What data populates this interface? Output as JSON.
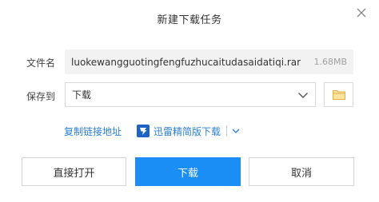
{
  "dialog": {
    "title": "新建下载任务"
  },
  "file": {
    "label": "文件名",
    "name": "luokewangguotingfengfuzhucaitudasaidatiqi.rar",
    "size": "1.68MB"
  },
  "save": {
    "label": "保存到",
    "path": "下载"
  },
  "links": {
    "copy_link": "复制链接地址",
    "thunder_label": "迅雷精简版下载"
  },
  "buttons": {
    "open_directly": "直接打开",
    "download": "下载",
    "cancel": "取消"
  },
  "icons": {
    "close": "close-icon",
    "chevron": "chevron-down-icon",
    "folder": "folder-icon",
    "thunder": "thunder-logo-icon"
  },
  "colors": {
    "primary": "#1a8ef5",
    "link": "#2a7fd4",
    "folder": "#f5c242"
  }
}
